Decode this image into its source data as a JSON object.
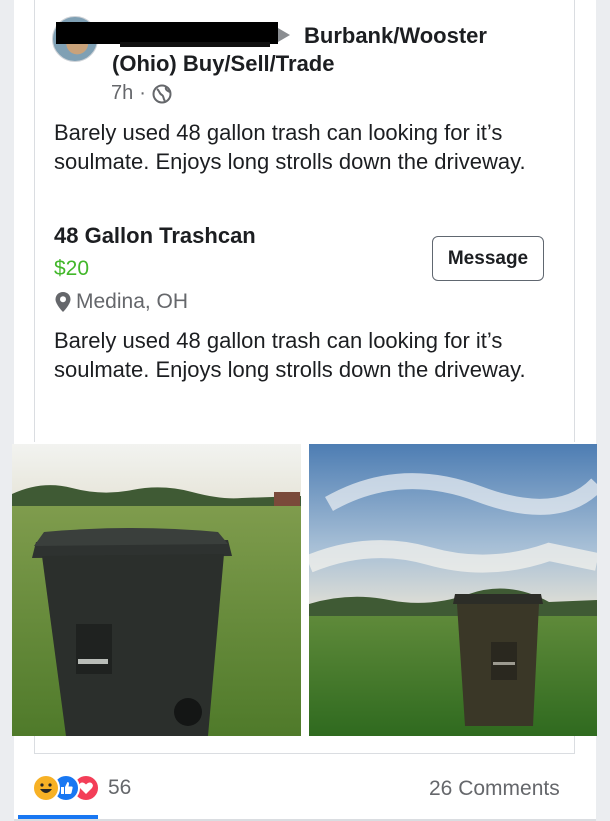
{
  "post": {
    "author_redacted": "",
    "group_line1": "Burbank/Wooster",
    "group_line2": "(Ohio) Buy/Sell/Trade",
    "time": "7h",
    "separator": "·",
    "audience_icon": "globe-icon",
    "text": "Barely used 48 gallon trash can looking for it’s soulmate. Enjoys long strolls down the driveway."
  },
  "listing": {
    "title": "48 Gallon Trashcan",
    "price": "$20",
    "location": "Medina, OH",
    "location_icon": "map-pin-icon",
    "description": "Barely used 48 gallon trash can looking for it’s soulmate. Enjoys long strolls down the driveway.",
    "message_button": "Message",
    "price_color": "#42b72a"
  },
  "photos": [
    {
      "icon": "photo-trashcan-field-closeup"
    },
    {
      "icon": "photo-trashcan-field-sky"
    }
  ],
  "footer": {
    "reaction_icons": [
      "haha-icon",
      "like-icon",
      "love-icon"
    ],
    "reaction_count": "56",
    "comments": "26 Comments"
  },
  "colors": {
    "accent": "#1877f2",
    "secondary_text": "#65676b"
  }
}
